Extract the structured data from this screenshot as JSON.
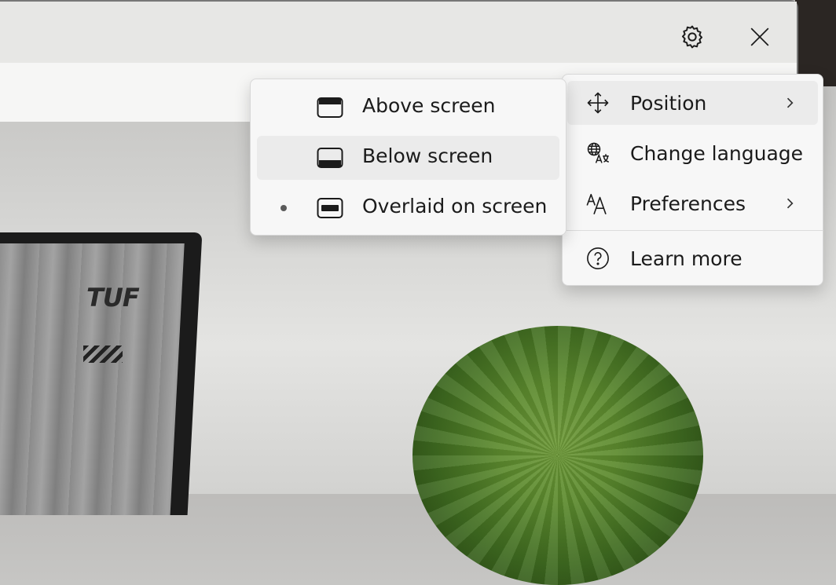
{
  "background": {
    "laptop_brand": "TUF"
  },
  "window": {
    "settings_icon": "gear-icon",
    "close_icon": "close-icon"
  },
  "menu": {
    "items": [
      {
        "label": "Position",
        "icon": "move-icon",
        "has_submenu": true
      },
      {
        "label": "Change language",
        "icon": "language-icon",
        "has_submenu": false
      },
      {
        "label": "Preferences",
        "icon": "font-size-icon",
        "has_submenu": true
      },
      {
        "label": "Learn more",
        "icon": "help-icon",
        "has_submenu": false
      }
    ]
  },
  "position_submenu": {
    "items": [
      {
        "label": "Above screen",
        "icon": "caption-top-icon",
        "selected": false
      },
      {
        "label": "Below screen",
        "icon": "caption-bottom-icon",
        "selected": false
      },
      {
        "label": "Overlaid on screen",
        "icon": "caption-overlay-icon",
        "selected": true
      }
    ]
  }
}
